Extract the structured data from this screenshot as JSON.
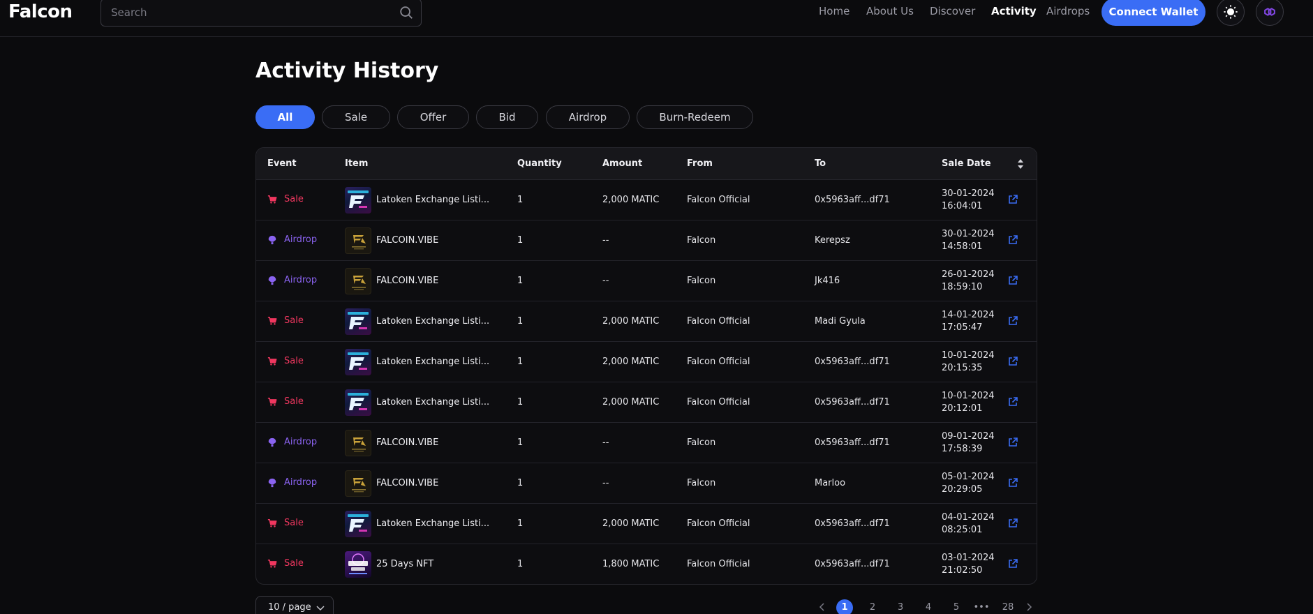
{
  "header": {
    "logo": "Falcon",
    "search_placeholder": "Search",
    "nav": [
      "Home",
      "About Us",
      "Discover",
      "Activity",
      "Airdrops"
    ],
    "active_nav": "Activity",
    "connect_label": "Connect Wallet",
    "accent_color": "#3a6df5"
  },
  "page": {
    "title": "Activity History",
    "filters": [
      "All",
      "Sale",
      "Offer",
      "Bid",
      "Airdrop",
      "Burn-Redeem"
    ],
    "active_filter": "All"
  },
  "table": {
    "columns": [
      "Event",
      "Item",
      "Quantity",
      "Amount",
      "From",
      "To",
      "Sale Date"
    ],
    "rows": [
      {
        "event": "Sale",
        "item": "Latoken Exchange Listi...",
        "thumb": "latoken",
        "quantity": "1",
        "amount": "2,000 MATIC",
        "from": "Falcon Official",
        "to": "0x5963aff...df71",
        "date": "30-01-2024",
        "time": "16:04:01"
      },
      {
        "event": "Airdrop",
        "item": "FALCOIN.VIBE",
        "thumb": "falcoin",
        "quantity": "1",
        "amount": "--",
        "from": "Falcon",
        "to": "Kerepsz",
        "date": "30-01-2024",
        "time": "14:58:01"
      },
      {
        "event": "Airdrop",
        "item": "FALCOIN.VIBE",
        "thumb": "falcoin",
        "quantity": "1",
        "amount": "--",
        "from": "Falcon",
        "to": "Jk416",
        "date": "26-01-2024",
        "time": "18:59:10"
      },
      {
        "event": "Sale",
        "item": "Latoken Exchange Listi...",
        "thumb": "latoken",
        "quantity": "1",
        "amount": "2,000 MATIC",
        "from": "Falcon Official",
        "to": "Madi Gyula",
        "date": "14-01-2024",
        "time": "17:05:47"
      },
      {
        "event": "Sale",
        "item": "Latoken Exchange Listi...",
        "thumb": "latoken",
        "quantity": "1",
        "amount": "2,000 MATIC",
        "from": "Falcon Official",
        "to": "0x5963aff...df71",
        "date": "10-01-2024",
        "time": "20:15:35"
      },
      {
        "event": "Sale",
        "item": "Latoken Exchange Listi...",
        "thumb": "latoken",
        "quantity": "1",
        "amount": "2,000 MATIC",
        "from": "Falcon Official",
        "to": "0x5963aff...df71",
        "date": "10-01-2024",
        "time": "20:12:01"
      },
      {
        "event": "Airdrop",
        "item": "FALCOIN.VIBE",
        "thumb": "falcoin",
        "quantity": "1",
        "amount": "--",
        "from": "Falcon",
        "to": "0x5963aff...df71",
        "date": "09-01-2024",
        "time": "17:58:39"
      },
      {
        "event": "Airdrop",
        "item": "FALCOIN.VIBE",
        "thumb": "falcoin",
        "quantity": "1",
        "amount": "--",
        "from": "Falcon",
        "to": "Marloo",
        "date": "05-01-2024",
        "time": "20:29:05"
      },
      {
        "event": "Sale",
        "item": "Latoken Exchange Listi...",
        "thumb": "latoken",
        "quantity": "1",
        "amount": "2,000 MATIC",
        "from": "Falcon Official",
        "to": "0x5963aff...df71",
        "date": "04-01-2024",
        "time": "08:25:01"
      },
      {
        "event": "Sale",
        "item": "25 Days NFT",
        "thumb": "days",
        "quantity": "1",
        "amount": "1,800 MATIC",
        "from": "Falcon Official",
        "to": "0x5963aff...df71",
        "date": "03-01-2024",
        "time": "21:02:50"
      }
    ],
    "event_colors": {
      "Sale": "#f0375f",
      "Airdrop": "#8a63f0"
    }
  },
  "pagination": {
    "per_page": "10 / page",
    "pages": [
      "1",
      "2",
      "3",
      "4",
      "5",
      "•••",
      "28"
    ],
    "current": "1"
  }
}
